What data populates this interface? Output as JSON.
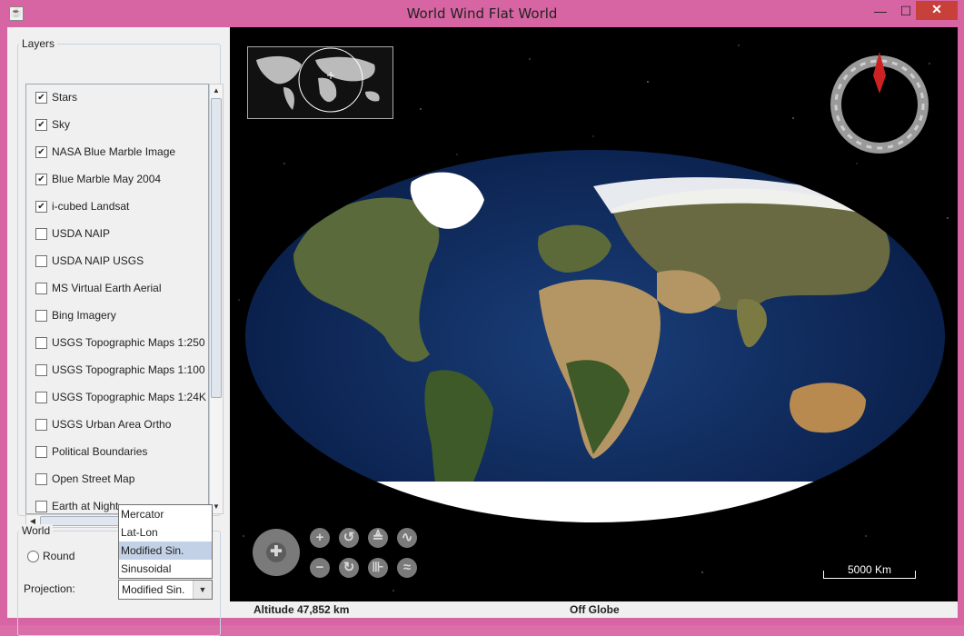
{
  "window": {
    "title": "World Wind Flat World",
    "minimize": "—",
    "maximize": "☐",
    "close": "✕"
  },
  "layers": {
    "legend": "Layers",
    "items": [
      {
        "label": "Stars",
        "checked": true
      },
      {
        "label": "Sky",
        "checked": true
      },
      {
        "label": "NASA Blue Marble Image",
        "checked": true
      },
      {
        "label": "Blue Marble May 2004",
        "checked": true
      },
      {
        "label": "i-cubed Landsat",
        "checked": true
      },
      {
        "label": "USDA NAIP",
        "checked": false
      },
      {
        "label": "USDA NAIP USGS",
        "checked": false
      },
      {
        "label": "MS Virtual Earth Aerial",
        "checked": false
      },
      {
        "label": "Bing Imagery",
        "checked": false
      },
      {
        "label": "USGS Topographic Maps 1:250",
        "checked": false
      },
      {
        "label": "USGS Topographic Maps 1:100",
        "checked": false
      },
      {
        "label": "USGS Topographic Maps 1:24K",
        "checked": false
      },
      {
        "label": "USGS Urban Area Ortho",
        "checked": false
      },
      {
        "label": "Political Boundaries",
        "checked": false
      },
      {
        "label": "Open Street Map",
        "checked": false
      },
      {
        "label": "Earth at Night",
        "checked": false
      }
    ]
  },
  "world": {
    "legend": "World",
    "round_label": "Round",
    "projection_label": "Projection:",
    "projection_value": "Modified Sin.",
    "projection_options": [
      "Mercator",
      "Lat-Lon",
      "Modified Sin.",
      "Sinusoidal"
    ],
    "selected_option_index": 2
  },
  "status": {
    "altitude": "Altitude  47,852 km",
    "globe": "Off Globe"
  },
  "map": {
    "scale_label": "5000 Km"
  },
  "icons": {
    "zoom_in": "+",
    "zoom_out": "−",
    "rotate_left": "↺",
    "rotate_right": "↻",
    "pitch_up": "≜",
    "pitch_down": "⊪",
    "exaggeration_up": "∿",
    "exaggeration_down": "≈",
    "pan": "✚"
  },
  "colors": {
    "window_border": "#d865a3",
    "close_button": "#c7413a",
    "map_background": "#000000",
    "selected_option": "#c3d1e6",
    "compass_needle": "#cc2222"
  }
}
